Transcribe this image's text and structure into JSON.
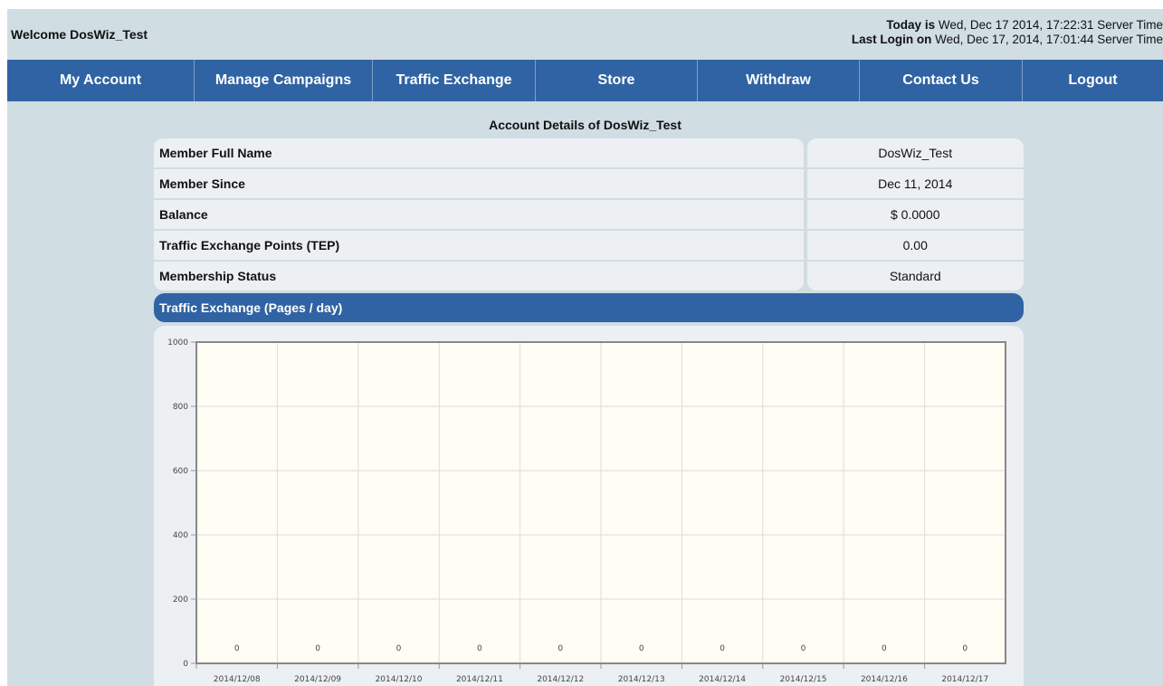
{
  "header": {
    "welcome": "Welcome DosWiz_Test",
    "today_label": "Today is",
    "today_value": "Wed, Dec 17 2014, 17:22:31 Server Time",
    "last_login_label": "Last Login on",
    "last_login_value": "Wed, Dec 17, 2014, 17:01:44 Server Time"
  },
  "nav": {
    "items": [
      "My Account",
      "Manage Campaigns",
      "Traffic Exchange",
      "Store",
      "Withdraw",
      "Contact Us",
      "Logout"
    ]
  },
  "account": {
    "title": "Account Details of DosWiz_Test",
    "rows": [
      {
        "label": "Member Full Name",
        "value": "DosWiz_Test"
      },
      {
        "label": "Member Since",
        "value": "Dec 11, 2014"
      },
      {
        "label": "Balance",
        "value": "$ 0.0000"
      },
      {
        "label": "Traffic Exchange Points (TEP)",
        "value": "0.00"
      },
      {
        "label": "Membership Status",
        "value": "Standard"
      }
    ]
  },
  "chart_header": "Traffic Exchange (Pages / day)",
  "chart_data": {
    "type": "bar",
    "categories": [
      "2014/12/08",
      "2014/12/09",
      "2014/12/10",
      "2014/12/11",
      "2014/12/12",
      "2014/12/13",
      "2014/12/14",
      "2014/12/15",
      "2014/12/16",
      "2014/12/17"
    ],
    "values": [
      0,
      0,
      0,
      0,
      0,
      0,
      0,
      0,
      0,
      0
    ],
    "title": "Traffic Exchange (Pages / day)",
    "ylim": [
      0,
      1000
    ],
    "yticks": [
      0,
      200,
      400,
      600,
      800,
      1000
    ],
    "grid": true,
    "plot_background": "#fffdf4",
    "grid_color": "#dcdcdc",
    "frame_color": "#888888"
  }
}
